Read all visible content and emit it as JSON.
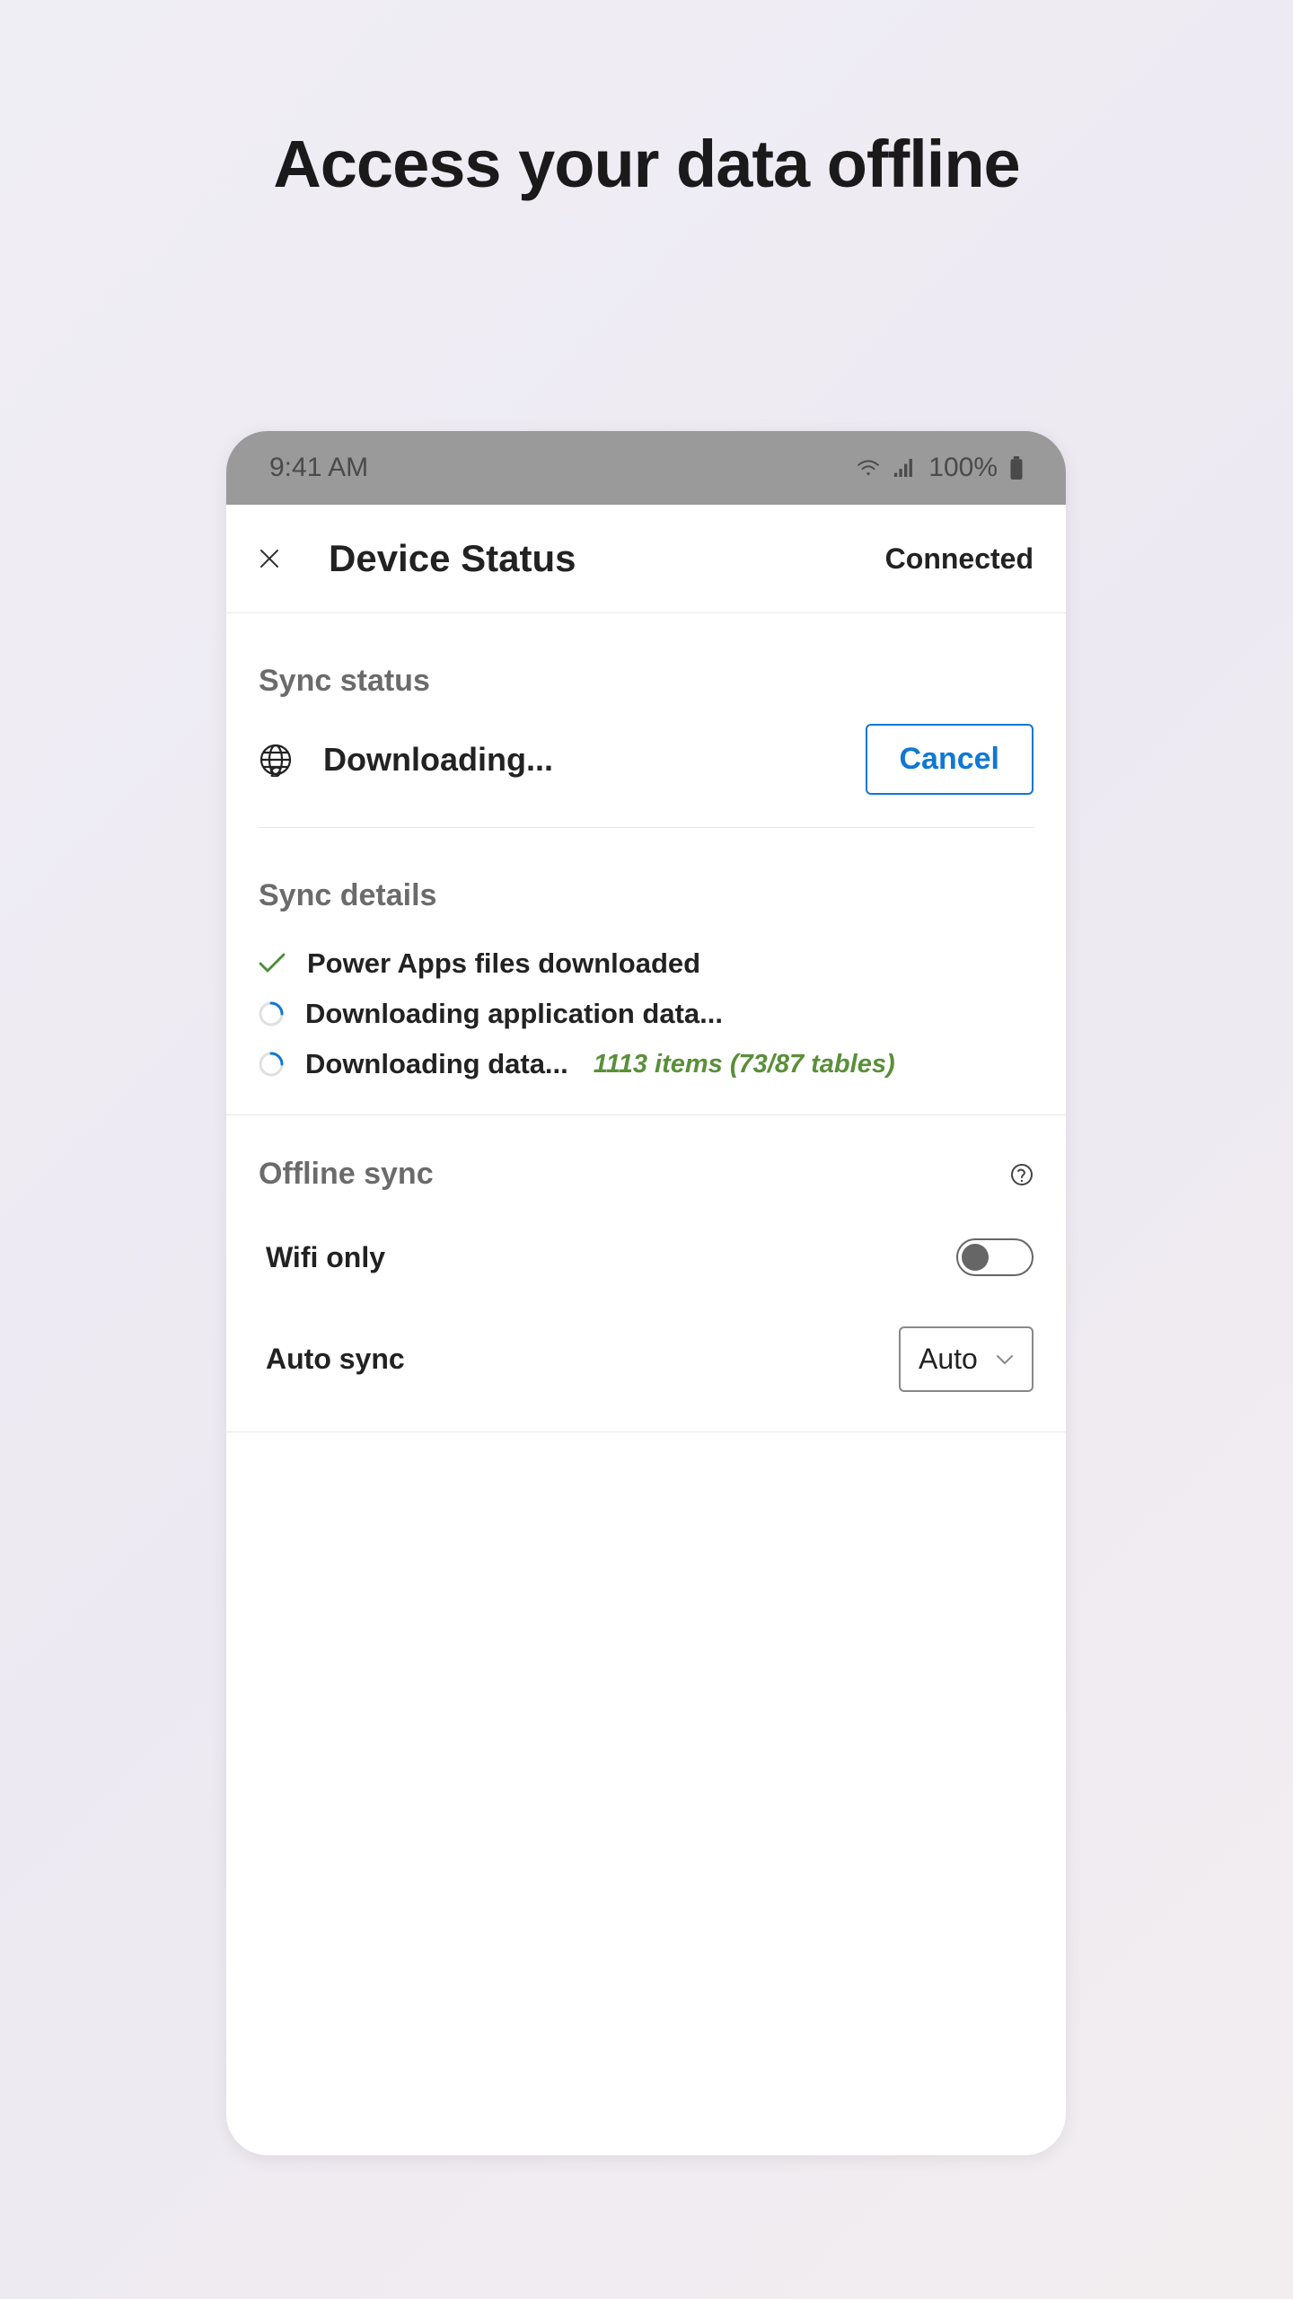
{
  "page": {
    "title": "Access your data offline"
  },
  "status_bar": {
    "time": "9:41 AM",
    "battery_text": "100%"
  },
  "header": {
    "title": "Device Status",
    "status": "Connected"
  },
  "sync_status": {
    "header": "Sync status",
    "text": "Downloading...",
    "cancel_label": "Cancel"
  },
  "sync_details": {
    "header": "Sync details",
    "item1": "Power Apps files downloaded",
    "item2": "Downloading application data...",
    "item3": "Downloading data...",
    "item3_meta": "1113 items (73/87 tables)"
  },
  "offline_sync": {
    "header": "Offline sync",
    "wifi_only_label": "Wifi only",
    "auto_sync_label": "Auto sync",
    "auto_sync_value": "Auto"
  }
}
